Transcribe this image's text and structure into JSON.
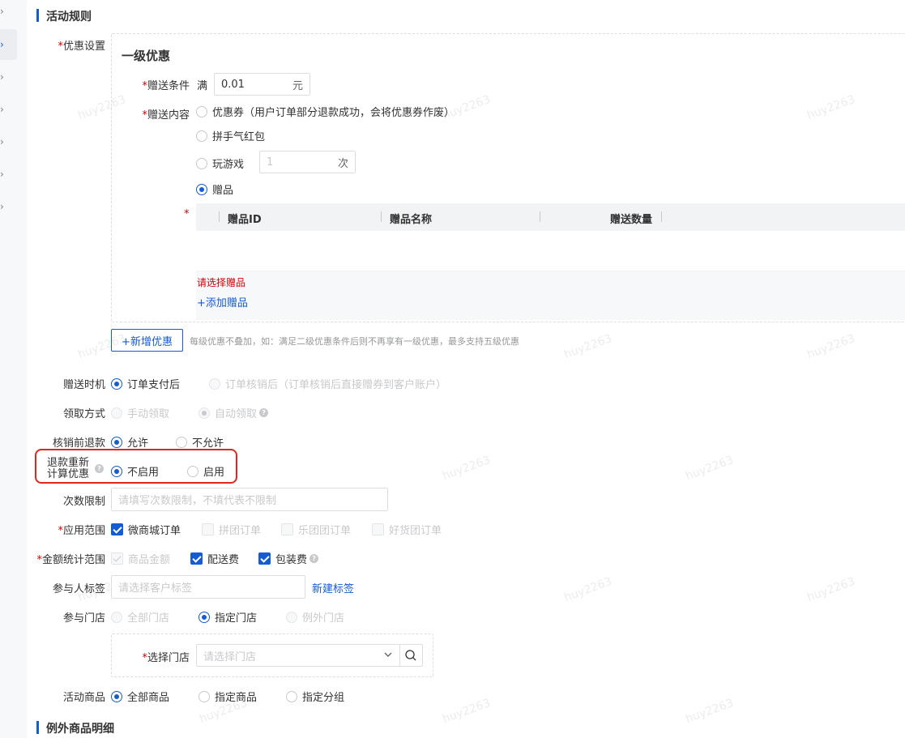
{
  "section1_title": "活动规则",
  "section2_title": "例外商品明细",
  "discount": {
    "label": "优惠设置",
    "level_title": "一级优惠",
    "condition_label": "赠送条件",
    "condition_prefix": "满",
    "condition_value": "0.01",
    "condition_suffix": "元",
    "content_label": "赠送内容",
    "options": {
      "coupon": "优惠券（用户订单部分退款成功，会将优惠券作废）",
      "redpack": "拼手气红包",
      "game": "玩游戏",
      "game_count_placeholder": "1",
      "game_count_suffix": "次",
      "gift": "赠品"
    },
    "table_headers": [
      "赠品ID",
      "赠品名称",
      "赠送数量"
    ],
    "error_text": "请选择赠品",
    "add_gift": "+添加赠品",
    "add_discount_button": "+新增优惠",
    "add_discount_hint": "每级优惠不叠加，如：满足二级优惠条件后则不再享有一级优惠，最多支持五级优惠"
  },
  "timing": {
    "label": "赠送时机",
    "opt1": "订单支付后",
    "opt2": "订单核销后（订单核销后直接赠券到客户账户）"
  },
  "receive": {
    "label": "领取方式",
    "opt1": "手动领取",
    "opt2": "自动领取"
  },
  "refund": {
    "label": "核销前退款",
    "opt1": "允许",
    "opt2": "不允许"
  },
  "recalc": {
    "label_line1": "退款重新",
    "label_line2": "计算优惠",
    "opt1": "不启用",
    "opt2": "启用",
    "highlight_color": "#e0271f"
  },
  "limit": {
    "label": "次数限制",
    "placeholder": "请填写次数限制，不填代表不限制"
  },
  "scope": {
    "label": "应用范围",
    "opt1": "微商城订单",
    "opt2": "拼团订单",
    "opt3": "乐团团订单",
    "opt4": "好货团订单"
  },
  "amount": {
    "label": "金额统计范围",
    "opt1": "商品金额",
    "opt2": "配送费",
    "opt3": "包装费"
  },
  "tags": {
    "label": "参与人标签",
    "placeholder": "请选择客户标签",
    "new_tag": "新建标签"
  },
  "stores": {
    "label": "参与门店",
    "opt1": "全部门店",
    "opt2": "指定门店",
    "opt3": "例外门店",
    "select_label": "选择门店",
    "select_placeholder": "请选择门店"
  },
  "goods": {
    "label": "活动商品",
    "opt1": "全部商品",
    "opt2": "指定商品",
    "opt3": "指定分组"
  },
  "watermark": "huy2263",
  "accent_color": "#155bd4"
}
